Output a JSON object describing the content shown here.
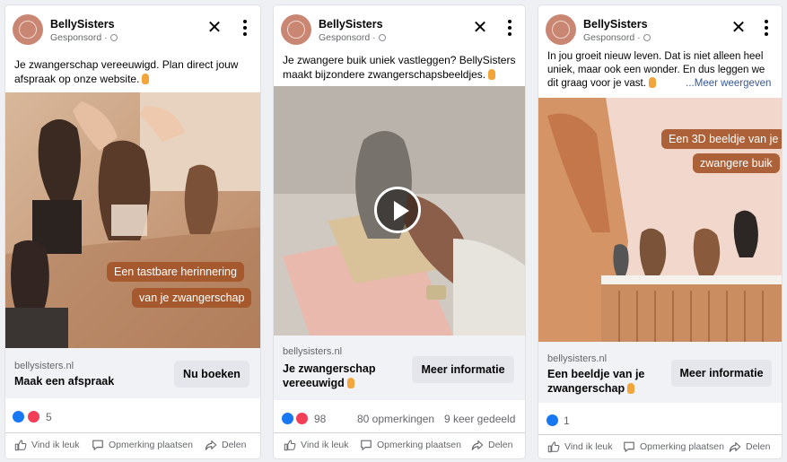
{
  "ads": [
    {
      "page_name": "BellySisters",
      "sponsored": "Gesponsord ·",
      "caption_lines": [
        "Je zwangerschap vereeuwigd. Plan direct jouw",
        "afspraak op onze website."
      ],
      "overlay": [
        "Een tastbare herinnering",
        "van je zwangerschap"
      ],
      "domain": "bellysisters.nl",
      "title_lines": [
        "Maak een afspraak"
      ],
      "cta": "Nu boeken",
      "reactions": "5",
      "actions": {
        "like": "Vind ik leuk",
        "comment": "Opmerking plaatsen",
        "share": "Delen"
      }
    },
    {
      "page_name": "BellySisters",
      "sponsored": "Gesponsord ·",
      "caption_lines": [
        "Je zwangere buik uniek vastleggen? BellySisters",
        "maakt bijzondere zwangerschapsbeeldjes."
      ],
      "overlay": [],
      "domain": "bellysisters.nl",
      "title_lines": [
        "Je zwangerschap",
        "vereeuwigd"
      ],
      "cta": "Meer informatie",
      "reactions": "98",
      "comments": "80 opmerkingen",
      "shares": "9 keer gedeeld",
      "actions": {
        "like": "Vind ik leuk",
        "comment": "Opmerking plaatsen",
        "share": "Delen"
      }
    },
    {
      "page_name": "BellySisters",
      "sponsored": "Gesponsord ·",
      "caption_lines": [
        "In jou groeit nieuw leven. Dat is niet alleen heel",
        "uniek, maar ook een wonder. En dus leggen we",
        "dit graag voor je vast."
      ],
      "see_more": "...Meer weergeven",
      "overlay": [
        "Een 3D beeldje van je",
        "zwangere buik"
      ],
      "domain": "bellysisters.nl",
      "title_lines": [
        "Een beeldje van je",
        "zwangerschap"
      ],
      "cta": "Meer informatie",
      "reactions": "1",
      "actions": {
        "like": "Vind ik leuk",
        "comment": "Opmerking plaatsen",
        "share": "Delen"
      }
    }
  ],
  "colors": {
    "like": "#1877f2",
    "heart": "#f33e58",
    "overlay": "#a45428",
    "link": "#385898"
  }
}
